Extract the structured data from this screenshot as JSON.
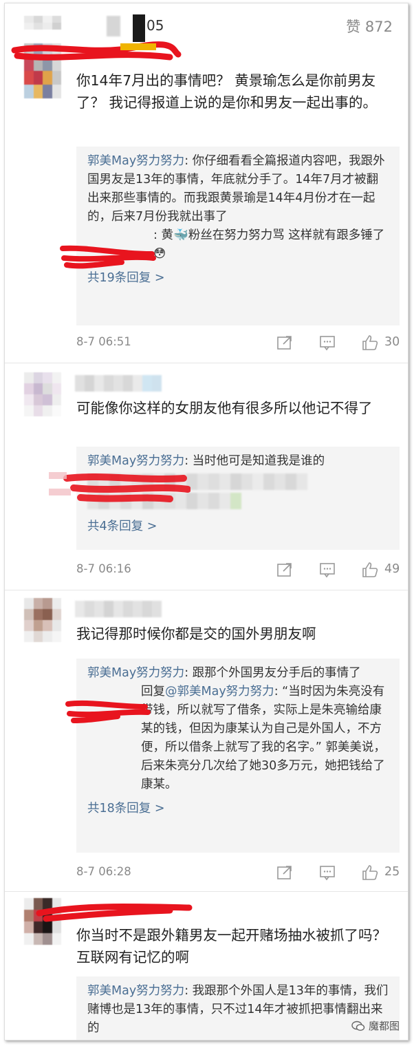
{
  "top": {
    "name_suffix": "05",
    "likes": "赞 872"
  },
  "comments": [
    {
      "text": "你14年7月出的事情吧？ 黄景瑜怎么是你前男友了？ 我记得报道上说的是你和男友一起出事的。",
      "reply1_name": "郭美May努力努力",
      "reply1_text": ": 你仔细看看全篇报道内容吧，我跟外国男友是13年的事情，年底就分手了。14年7月才被翻出来那些事情的。而我跟黄景瑜是14年4月份才在一起的，后来7月份我就出事了",
      "reply2_text": ": 黄🐳粉丝在努力努力骂 这样就有跟多锤了😳",
      "more": "共19条回复 >",
      "time": "8-7 06:51",
      "likes": "30"
    },
    {
      "text": "可能像你这样的女朋友他有很多所以他记不得了",
      "reply1_name": "郭美May努力努力",
      "reply1_text": ": 当时他可是知道我是谁的",
      "more": "共4条回复 >",
      "time": "8-7 06:16",
      "likes": "49"
    },
    {
      "text": "我记得那时候你都是交的国外男朋友啊",
      "reply1_name": "郭美May努力努力",
      "reply1_text": ": 跟那个外国男友分手后的事情了",
      "reply2_prefix": "回复",
      "reply2_at": "@郭美May努力努力",
      "reply2_text": ": “当时因为朱亮没有带钱，所以就写了借条，实际上是朱亮输给康某的钱，但因为康某认为自己是外国人，不方便，所以借条上就写了我的名字。” 郭美美说，后来朱亮分几次给了她30多万元，她把钱给了康某。",
      "more": "共18条回复 >",
      "time": "8-7 06:28",
      "likes": "25"
    },
    {
      "text": "你当时不是跟外籍男友一起开赌场抽水被抓了吗？互联网有记忆的啊",
      "reply1_name": "郭美May努力努力",
      "reply1_text": ": 我跟那个外国人是13年的事情，我们赌博也是13年的事情，只不过14年才被抓把事情翻出来的"
    }
  ],
  "watermark": "魔都图",
  "colors": {
    "link": "#4a6e93",
    "scribble": "#e8141e",
    "meta": "#8a8a8a"
  }
}
